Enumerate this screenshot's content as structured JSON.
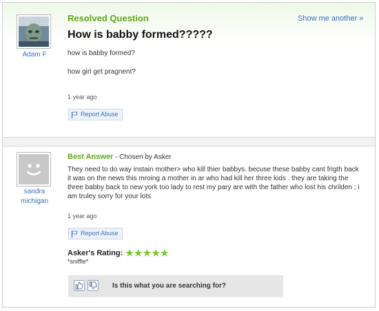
{
  "question": {
    "status_label": "Resolved Question",
    "show_another_label": "Show me another »",
    "title": "How is babby formed?????",
    "details_line1": "how is babby formed?",
    "details_line2": "how girl get pragnent?",
    "timestamp": "1 year ago",
    "report_label": "Report Abuse",
    "asker_name": "Adam F",
    "avatar_icon": "user-photo"
  },
  "answer": {
    "heading": "Best Answer",
    "chosen_by": " - Chosen by Asker",
    "responder_name_line1": "sandra",
    "responder_name_line2": "michigan",
    "avatar_icon": "default-avatar",
    "body": "They need to do way instain mother> who kill thier babbys. becuse these babby cant frigth back it was on the news this mroing a mother in ar who had kill her three kids . they are taking the three babby back to new york too lady to rest my pary are with the father who lost his chrilden ; i am truley sorry for your lots",
    "timestamp": "1 year ago",
    "report_label": "Report Abuse",
    "rating_label": "Asker's Rating:",
    "rating_stars": "★★★★★",
    "rating_value": 5,
    "rating_max": 5,
    "rating_comment": "*sniffle*"
  },
  "feedback": {
    "prompt": "Is this what you are searching for?",
    "thumbs_up_icon": "thumbs-up-icon",
    "thumbs_down_icon": "thumbs-down-icon"
  },
  "colors": {
    "accent_green": "#5ea817",
    "link_blue": "#3a6fc0",
    "star_green": "#74c82a"
  }
}
